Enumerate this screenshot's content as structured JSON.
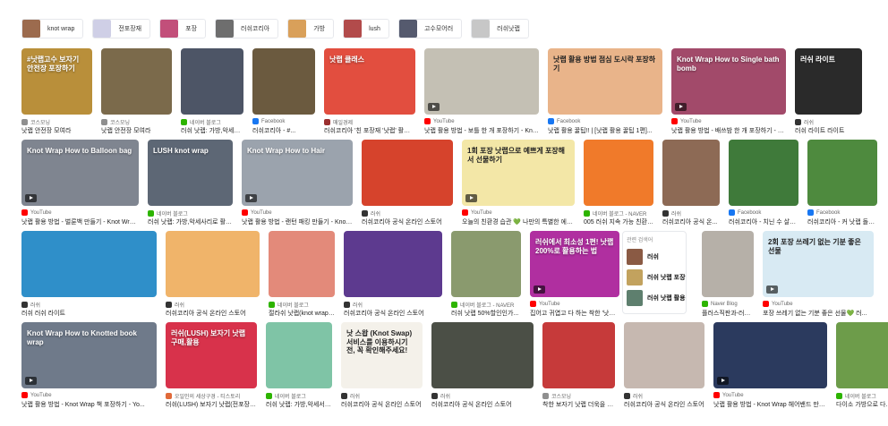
{
  "chips": [
    {
      "label": "knot wrap",
      "color": "#9c6b4e"
    },
    {
      "label": "전포장재",
      "color": "#cfcfe6"
    },
    {
      "label": "포장",
      "color": "#c24f7a"
    },
    {
      "label": "러쉬코리아",
      "color": "#6e6e6e"
    },
    {
      "label": "가방",
      "color": "#d9a05a"
    },
    {
      "label": "lush",
      "color": "#b24b4b"
    },
    {
      "label": "고수모어러",
      "color": "#555a6e"
    },
    {
      "label": "러쉬낫랩",
      "color": "#c7c7c7"
    }
  ],
  "related": {
    "title": "관련 검색어",
    "items": [
      {
        "label": "러쉬",
        "color": "#8a5a44"
      },
      {
        "label": "러쉬 낫랩 포장",
        "color": "#c2a25e"
      },
      {
        "label": "러쉬 낫랩 활용",
        "color": "#5e7f6e"
      }
    ]
  },
  "tiles": [
    {
      "thumb_text": "#낫랩고수 보자기 안전장 포장하기",
      "source": "코스모닝",
      "caption": "낫랩 안전장 모여라",
      "color": "#b98f3a",
      "icon": "#8f8f8f",
      "video": false
    },
    {
      "thumb_text": "",
      "source": "코스모닝",
      "caption": "낫랩 안전장 모여라",
      "color": "#7b6a4b",
      "icon": "#8f8f8f",
      "video": false
    },
    {
      "thumb_text": "",
      "source": "네이버 블로그",
      "caption": "러쉬 낫랩: 가방,악세서리,...",
      "color": "#4d5566",
      "icon": "#2db400",
      "video": false
    },
    {
      "thumb_text": "",
      "source": "Facebook",
      "caption": "러쉬코리아 - #...",
      "color": "#6b5a3f",
      "icon": "#1877f2",
      "video": false
    },
    {
      "thumb_text": "낫랩 클래스",
      "source": "매일경제",
      "caption": "러쉬코리아 '친 포장재 '낫랩' 활용법...",
      "color": "#e24e3f",
      "icon": "#9a2f2f",
      "video": false
    },
    {
      "thumb_text": "",
      "source": "YouTube",
      "caption": "낫랩 활용 방법 - 보틀 한 개 포장하기 - Knot ...",
      "color": "#c4c0b4",
      "icon": "#ff0000",
      "video": true
    },
    {
      "thumb_text": "낫랩 활용 방법 점심 도시락 포장하기",
      "source": "Facebook",
      "caption": "낫랩 활용 꿀팁!! | [낫랩 활용 꿀팁 1편]...",
      "color": "#e9b48a",
      "icon": "#1877f2",
      "video": false
    },
    {
      "thumb_text": "Knot Wrap How to Single bath bomb",
      "source": "YouTube",
      "caption": "낫랩 활용 방법 - 배쓰밤 한 개 포장하기 - Kn...",
      "color": "#a24a6a",
      "icon": "#ff0000",
      "video": true
    },
    {
      "thumb_text": "러쉬 라이트",
      "source": "러쉬",
      "caption": "러쉬 라이트 라이트",
      "color": "#2a2a2a",
      "icon": "#333333",
      "video": false
    },
    {
      "thumb_text": "Knot Wrap How to Balloon bag",
      "source": "YouTube",
      "caption": "낫랩 활용 방법 - 벌룬백 만들기 - Knot Wrap ...",
      "color": "#7f8590",
      "icon": "#ff0000",
      "video": true
    },
    {
      "thumb_text": "LUSH knot wrap",
      "source": "네이버 블로그",
      "caption": "러쉬 낫랩: 가방,악세사리로 활용...",
      "color": "#5d6775",
      "icon": "#2db400",
      "video": false
    },
    {
      "thumb_text": "Knot Wrap How to Hair",
      "source": "YouTube",
      "caption": "낫랩 활용 방법 - 랜턴 패킹 만들기 - Knot W...",
      "color": "#9ba3ad",
      "icon": "#ff0000",
      "video": true
    },
    {
      "thumb_text": "",
      "source": "러쉬",
      "caption": "러쉬코리아 공식 온라인 스토어",
      "color": "#d6432c",
      "icon": "#333333",
      "video": false
    },
    {
      "thumb_text": "1회 포장 낫랩으로 예쁘게 포장해서 선물하기",
      "source": "YouTube",
      "caption": "오늘의 친환경 습관 💚 나만의 특별한 에코백...",
      "color": "#f3e7a7",
      "icon": "#ff0000",
      "video": true
    },
    {
      "thumb_text": "",
      "source": "네이버 블로그 - NAVER",
      "caption": "005 러쉬 지속 가능 친환경 ...",
      "color": "#f07a2a",
      "icon": "#2db400",
      "video": false
    },
    {
      "thumb_text": "",
      "source": "러쉬",
      "caption": "러쉬코리아 공식 온...",
      "color": "#8d6a55",
      "icon": "#333333",
      "video": false
    },
    {
      "thumb_text": "",
      "source": "Facebook",
      "caption": "러쉬코리아 - 치닌 수 살끝...",
      "color": "#3f7a3a",
      "icon": "#1877f2",
      "video": false
    },
    {
      "thumb_text": "",
      "source": "Facebook",
      "caption": "러쉬코리아 - 커 낫랩 돌가...",
      "color": "#4e8a3e",
      "icon": "#1877f2",
      "video": false
    },
    {
      "thumb_text": "",
      "source": "러쉬",
      "caption": "러쉬 러쉬 라이트",
      "color": "#2f8fc9",
      "icon": "#333333",
      "video": false
    },
    {
      "thumb_text": "",
      "source": "러쉬",
      "caption": "러쉬코리아 공식 온라인 스토어",
      "color": "#f0b46a",
      "icon": "#333333",
      "video": false
    },
    {
      "thumb_text": "",
      "source": "네이버 블로그",
      "caption": "절라쉬 낫랩(knot wrap)...",
      "color": "#e38a7a",
      "icon": "#2db400",
      "video": false
    },
    {
      "thumb_text": "",
      "source": "러쉬",
      "caption": "러쉬코리아 공식 온라인 스토어",
      "color": "#5d3a8f",
      "icon": "#333333",
      "video": false
    },
    {
      "thumb_text": "",
      "source": "네이버 블로그 - NAVER",
      "caption": "러쉬 낫랩 50%할인인가...",
      "color": "#8a9a6e",
      "icon": "#2db400",
      "video": false
    },
    {
      "thumb_text": "러쉬에서 최소성 1편! 낫랩 200%로 활용하는 법",
      "source": "YouTube",
      "caption": "집어고 귀엽고 다 하는 착한 '낫랩'...",
      "color": "#b02fa0",
      "icon": "#ff0000",
      "video": true
    },
    {
      "thumb_text": "",
      "source": "Naver Blog",
      "caption": "플러스직판과-러쉬...",
      "color": "#b6b0a8",
      "icon": "#2db400",
      "video": false
    },
    {
      "thumb_text": "2회 포장 쓰레기 없는 기분 좋은 선물",
      "source": "YouTube",
      "caption": "포장 쓰레기 없는 기분 좋은 선물💚 러...",
      "color": "#d8eaf3",
      "icon": "#ff0000",
      "video": true
    },
    {
      "thumb_text": "Knot Wrap How to Knotted book wrap",
      "source": "YouTube",
      "caption": "낫랩 활용 방법 - Knot Wrap 책 포장하기 - Yo...",
      "color": "#6f7a8a",
      "icon": "#ff0000",
      "video": true
    },
    {
      "thumb_text": "러쉬(LUSH) 보자기 낫랩 구매,활용",
      "source": "오일인의 세상구경 - 티스토리",
      "caption": "러쉬(LUSH) 보자기 낫랩(전포장재), 활용...",
      "color": "#d8324b",
      "icon": "#e06a3a",
      "video": false
    },
    {
      "thumb_text": "",
      "source": "네이버 블로그",
      "caption": "러쉬 낫랩: 가방,악세서리...",
      "color": "#7fc4a6",
      "icon": "#2db400",
      "video": false
    },
    {
      "thumb_text": "낫 스왑 (Knot Swap) 서비스를 이용하시기 전, 꼭 확인해주세요!",
      "source": "러쉬",
      "caption": "러쉬코리아 공식 온라인 스토어",
      "color": "#f4f1ea",
      "icon": "#333333",
      "video": false
    },
    {
      "thumb_text": "",
      "source": "러쉬",
      "caption": "러쉬코리아 공식 온라인 스토어",
      "color": "#4b4f46",
      "icon": "#333333",
      "video": false
    },
    {
      "thumb_text": "",
      "source": "코스모닝",
      "caption": "착한 보자기 낫랩 더욱을 한하세...",
      "color": "#c63a3a",
      "icon": "#8f8f8f",
      "video": false
    },
    {
      "thumb_text": "",
      "source": "러쉬",
      "caption": "러쉬코리아 공식 온라인 스토어",
      "color": "#c6b8b0",
      "icon": "#333333",
      "video": false
    },
    {
      "thumb_text": "",
      "source": "YouTube",
      "caption": "낫랩 활용 방법 - Knot Wrap 헤어밴드 만들기...",
      "color": "#2b3a5e",
      "icon": "#ff0000",
      "video": true
    },
    {
      "thumb_text": "",
      "source": "네이버 블로그",
      "caption": "다이소 가방으로 다...",
      "color": "#6d9c4a",
      "icon": "#2db400",
      "video": false
    }
  ]
}
